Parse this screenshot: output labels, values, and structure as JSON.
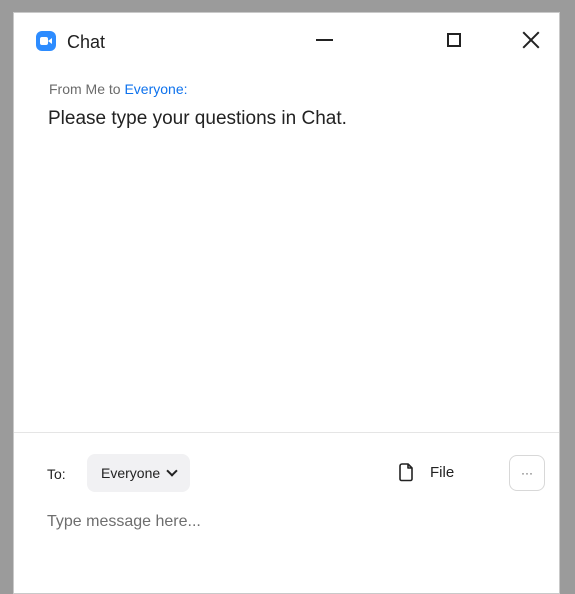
{
  "window": {
    "title": "Chat",
    "icon": "zoom-video-icon",
    "controls": {
      "minimize_icon": "minimize-icon",
      "maximize_icon": "maximize-icon",
      "close_icon": "close-icon"
    }
  },
  "messages": [
    {
      "from_prefix": "From Me to",
      "recipient": "Everyone:",
      "text": "Please type your questions in Chat."
    }
  ],
  "compose": {
    "to_label": "To:",
    "recipient_selected": "Everyone",
    "file_label": "File",
    "more_label": "···",
    "placeholder": "Type message here..."
  },
  "colors": {
    "accent": "#0e72ed",
    "app_icon": "#2d8cff",
    "dropdown_bg": "#f1f1f3"
  }
}
